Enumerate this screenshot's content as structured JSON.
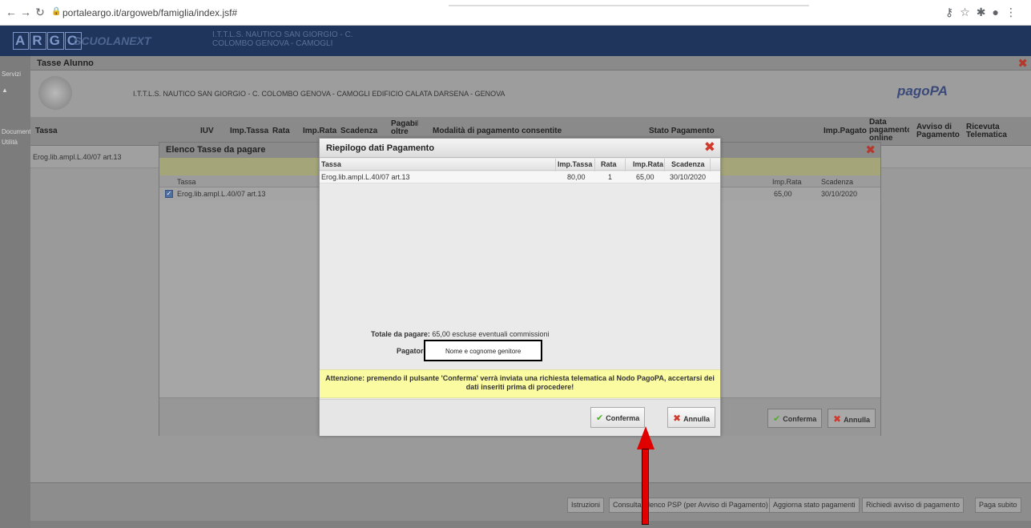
{
  "browser": {
    "url": "portaleargo.it/argoweb/famiglia/index.jsf#"
  },
  "app": {
    "logo_letters": [
      "A",
      "R",
      "G",
      "O"
    ],
    "product": "SCUOLANEXT",
    "school_header_line1": "I.T.T.L.S. NAUTICO SAN GIORGIO - C.",
    "school_header_line2": "COLOMBO GENOVA - CAMOGLI"
  },
  "left_strip": {
    "items": [
      "Servizi",
      "Documenti",
      "Utilità"
    ]
  },
  "window": {
    "title": "Tasse Alunno",
    "school_line": "I.T.T.L.S. NAUTICO SAN GIORGIO - C. COLOMBO GENOVA - CAMOGLI EDIFICIO CALATA DARSENA - GENOVA",
    "pagopa_logo": "pagoPA",
    "columns": {
      "tassa": "Tassa",
      "iuv": "IUV",
      "imp_tassa": "Imp.Tassa",
      "rata": "Rata",
      "imp_rata": "Imp.Rata",
      "scadenza": "Scadenza",
      "pagabile_oltre": "Pagabile oltre",
      "modalita": "Modalità di pagamento consentite",
      "stato": "Stato Pagamento",
      "imp_pagato": "Imp.Pagato",
      "data_pagamento": "Data pagamento online",
      "avviso": "Avviso di Pagamento",
      "ricevuta": "Ricevuta Telematica"
    },
    "row": {
      "tassa": "Erog.lib.ampl.L.40/07 art.13"
    },
    "bottom_buttons": [
      "Istruzioni",
      "Consulta Elenco PSP (per Avviso di Pagamento)",
      "Aggiorna stato pagamenti",
      "Richiedi avviso di pagamento",
      "Paga subito"
    ]
  },
  "elenco": {
    "title": "Elenco Tasse da pagare",
    "col_tassa": "Tassa",
    "col_imp_rata": "Imp.Rata",
    "col_scadenza": "Scadenza",
    "row": {
      "tassa": "Erog.lib.ampl.L.40/07 art.13",
      "imp_rata": "65,00",
      "scadenza": "30/10/2020",
      "checked": true
    },
    "confirm_label": "Conferma",
    "cancel_label": "Annulla"
  },
  "riepilogo": {
    "title": "Riepilogo dati Pagamento",
    "columns": {
      "tassa": "Tassa",
      "imp_tassa": "Imp.Tassa",
      "rata": "Rata",
      "imp_rata": "Imp.Rata",
      "scadenza": "Scadenza"
    },
    "row": {
      "tassa": "Erog.lib.ampl.L.40/07 art.13",
      "imp_tassa": "80,00",
      "rata": "1",
      "imp_rata": "65,00",
      "scadenza": "30/10/2020"
    },
    "totale_label": "Totale da pagare:",
    "totale_value": "65,00 escluse eventuali commissioni",
    "pagatore_label": "Pagatore:",
    "pagatore_value": "Nome e cognome genitore",
    "warning": "Attenzione: premendo il pulsante 'Conferma' verrà inviata una richiesta telematica al Nodo PagoPA, accertarsi dei dati inseriti prima di procedere!",
    "confirm_label": "Conferma",
    "cancel_label": "Annulla"
  },
  "colors": {
    "header_bg": "#20355c",
    "warning_bg": "#fbfba2",
    "close_red": "#d0392b",
    "confirm_green": "#4caf27",
    "annotation_arrow": "#e00000"
  }
}
